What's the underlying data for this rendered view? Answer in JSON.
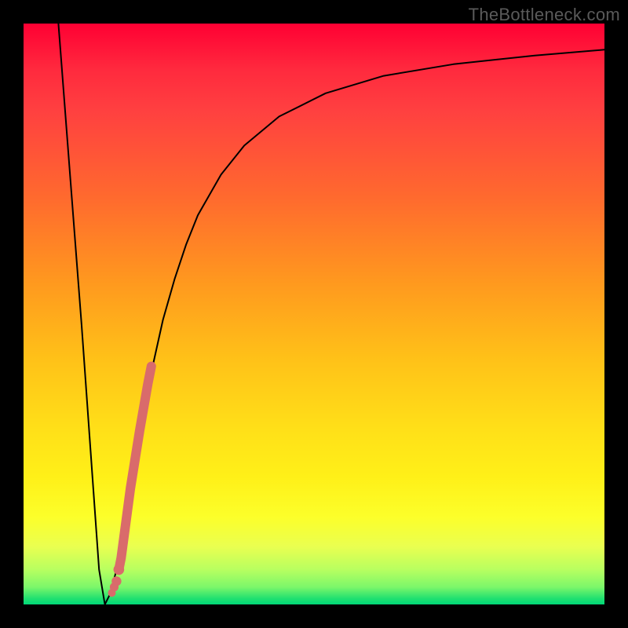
{
  "watermark": "TheBottleneck.com",
  "chart_data": {
    "type": "line",
    "title": "",
    "xlabel": "",
    "ylabel": "",
    "xlim": [
      0,
      100
    ],
    "ylim": [
      0,
      100
    ],
    "series": [
      {
        "name": "bottleneck-curve",
        "x": [
          6,
          8,
          10,
          12,
          13,
          14,
          15,
          16,
          18,
          20,
          22,
          24,
          26,
          28,
          30,
          34,
          38,
          44,
          52,
          62,
          74,
          88,
          100
        ],
        "y": [
          100,
          74,
          48,
          20,
          6,
          0,
          2,
          6,
          18,
          30,
          40,
          49,
          56,
          62,
          67,
          74,
          79,
          84,
          88,
          91,
          93,
          94.5,
          95.5
        ],
        "stroke": "#000",
        "stroke_width": 2
      }
    ],
    "markers": {
      "name": "highlight-segment",
      "color": "#d96b6b",
      "points": [
        {
          "x": 15.2,
          "y": 2
        },
        {
          "x": 15.6,
          "y": 3
        },
        {
          "x": 16.0,
          "y": 4
        },
        {
          "x": 16.4,
          "y": 6
        },
        {
          "x": 16.8,
          "y": 8
        },
        {
          "x": 17.6,
          "y": 14
        },
        {
          "x": 18.4,
          "y": 20
        },
        {
          "x": 19.2,
          "y": 25
        },
        {
          "x": 20.0,
          "y": 30
        },
        {
          "x": 20.7,
          "y": 34
        },
        {
          "x": 21.4,
          "y": 38
        },
        {
          "x": 22.0,
          "y": 41
        }
      ]
    }
  }
}
